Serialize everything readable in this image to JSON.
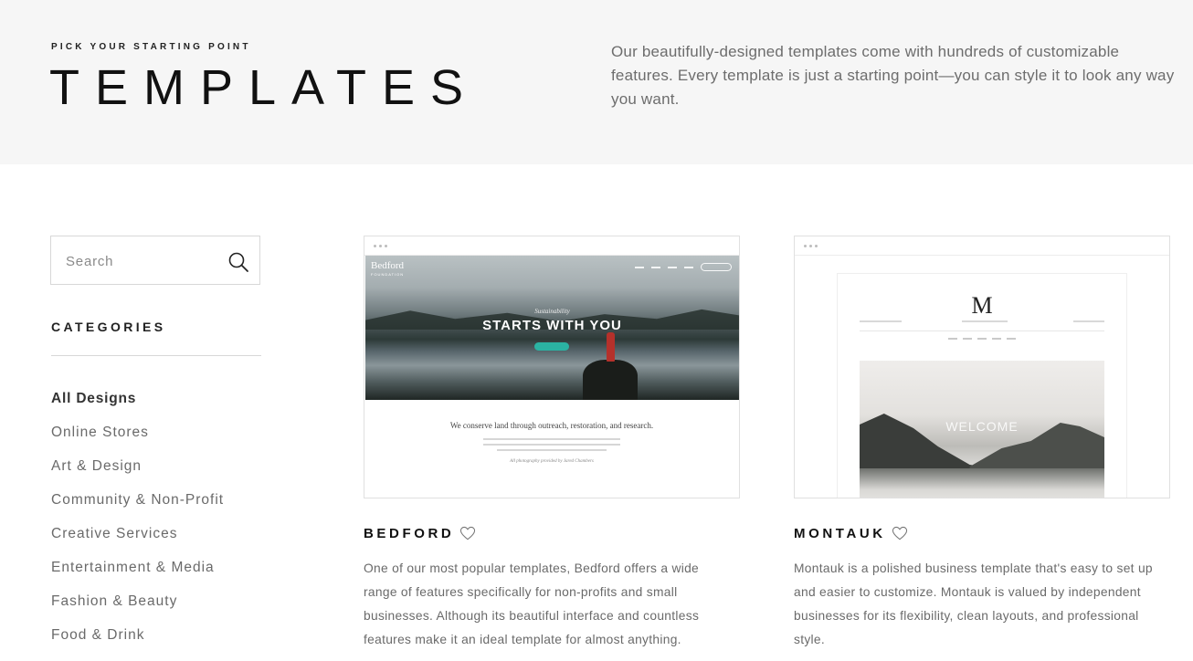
{
  "hero": {
    "eyebrow": "PICK YOUR STARTING POINT",
    "title": "TEMPLATES",
    "description": "Our beautifully-designed templates come with hundreds of customizable features. Every template is just a starting point—you can style it to look any way you want."
  },
  "sidebar": {
    "search": {
      "placeholder": "Search",
      "value": "",
      "icon": "search-icon"
    },
    "categories_heading": "CATEGORIES",
    "categories": [
      "All Designs",
      "Online Stores",
      "Art & Design",
      "Community & Non-Profit",
      "Creative Services",
      "Entertainment & Media",
      "Fashion & Beauty",
      "Food & Drink"
    ],
    "active_category": "All Designs"
  },
  "templates": [
    {
      "name": "BEDFORD",
      "favorite_icon": "heart-outline-icon",
      "description": "One of our most popular templates, Bedford offers a wide range of features specifically for non-profits and small businesses. Although its beautiful interface and countless features make it an ideal template for almost anything.",
      "preview": {
        "logo": "Bedford",
        "logo_sub": "FOUNDATION",
        "kicker": "Sustainability",
        "headline": "STARTS WITH YOU",
        "body_title": "We conserve land through outreach, restoration, and research.",
        "credit": "All photography provided by Jared Chambers"
      }
    },
    {
      "name": "MONTAUK",
      "favorite_icon": "heart-outline-icon",
      "description": "Montauk is a polished business template that's easy to set up and easier to customize. Montauk is valued by independent businesses for its flexibility, clean layouts, and professional style.",
      "preview": {
        "logo": "M",
        "welcome": "WELCOME"
      }
    }
  ],
  "colors": {
    "hero_bg": "#f6f6f6",
    "accent_teal": "#2bb3a3",
    "text_dark": "#111111",
    "text_muted": "#6a6a6a"
  }
}
